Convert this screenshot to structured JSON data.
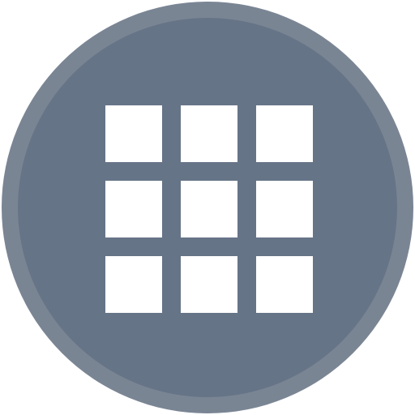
{
  "app_launcher": {
    "icon": "grid-icon",
    "tile_count": 9,
    "rows": 3,
    "columns": 3,
    "colors": {
      "ring": "#7a8594",
      "face": "#667487",
      "tiles": "#ffffff",
      "background": "#ffffff"
    }
  }
}
